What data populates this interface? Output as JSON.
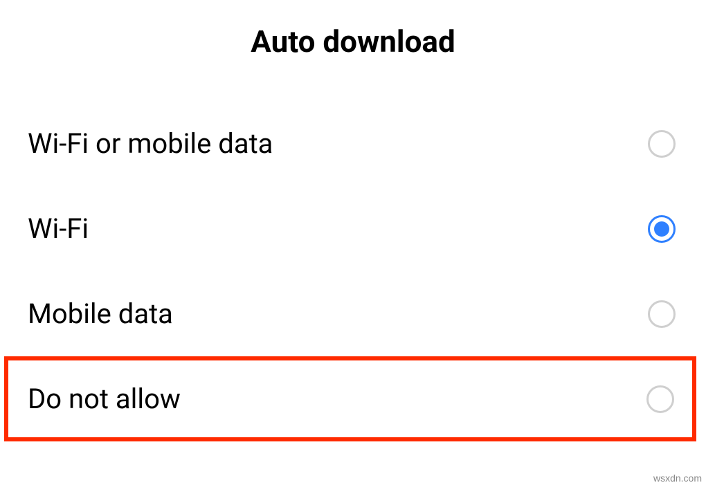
{
  "title": "Auto download",
  "options": [
    {
      "label": "Wi-Fi or mobile data",
      "selected": false,
      "highlighted": false
    },
    {
      "label": "Wi-Fi",
      "selected": true,
      "highlighted": false
    },
    {
      "label": "Mobile data",
      "selected": false,
      "highlighted": false
    },
    {
      "label": "Do not allow",
      "selected": false,
      "highlighted": true
    }
  ],
  "watermark": "wsxdn.com"
}
